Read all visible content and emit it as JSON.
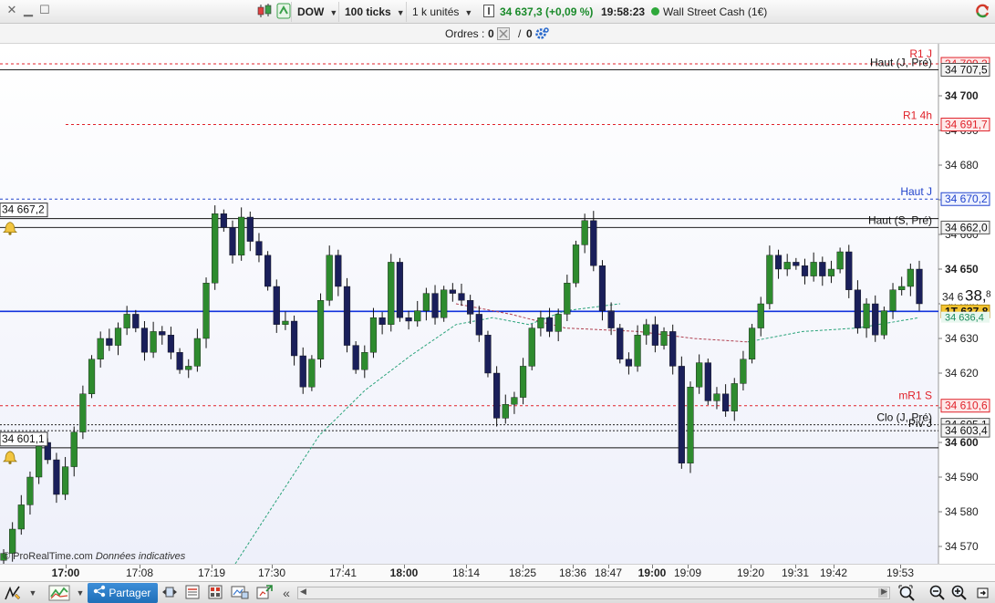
{
  "toolbar": {
    "symbol": "DOW",
    "ticks": "100 ticks",
    "units": "1 k unités",
    "price_info": "34 637,3 (+0,09 %)",
    "time": "19:58:23",
    "instrument": "Wall Street Cash (1€)"
  },
  "orders": {
    "label": "Ordres :",
    "count1": "0",
    "sep": "/",
    "count2": "0"
  },
  "watermark": "© ProRealTime.com",
  "watermark_note": "Données indicatives",
  "share_label": "Partager",
  "colors": {
    "up": "#2e8b2e",
    "down": "#1a1f5a",
    "resistance": "#e0222a",
    "support": "#222222",
    "haut_j": "#2244cc",
    "price_line": "#1133dd",
    "ma": "#2aa37a"
  },
  "chart_data": {
    "type": "candlestick",
    "ylim": [
      34565,
      34715
    ],
    "y_ticks": [
      "34 570",
      "34 580",
      "34 590",
      "34 600",
      "34 610",
      "34 620",
      "34 630",
      "34 640",
      "34 650",
      "34 660",
      "34 670",
      "34 680",
      "34 690",
      "34 700"
    ],
    "y_tick_values": [
      34570,
      34580,
      34590,
      34600,
      34610,
      34620,
      34630,
      34640,
      34650,
      34660,
      34670,
      34680,
      34690,
      34700
    ],
    "x_labels": [
      "17:00",
      "17:08",
      "17:19",
      "17:30",
      "17:41",
      "18:00",
      "18:14",
      "18:25",
      "18:36",
      "18:47",
      "19:00",
      "19:09",
      "19:20",
      "19:31",
      "19:42",
      "19:53"
    ],
    "x_bold": [
      true,
      false,
      false,
      false,
      false,
      true,
      false,
      false,
      false,
      false,
      true,
      false,
      false,
      false,
      false,
      false
    ],
    "levels": [
      {
        "name": "R1 J",
        "value": 34709.2,
        "label": "34 709,2",
        "style": "red-dash"
      },
      {
        "name": "Haut (J, Pré)",
        "value": 34707.5,
        "label": "34 707,5",
        "style": "black"
      },
      {
        "name": "R1 4h",
        "value": 34691.7,
        "label": "34 691,7",
        "style": "red-dash"
      },
      {
        "name": "Haut J",
        "value": 34670.2,
        "label": "34 670,2",
        "style": "blue-dash"
      },
      {
        "name": "Haut (S, Pré)",
        "value": 34662.0,
        "label": "34 662,0",
        "style": "black"
      },
      {
        "name": "mR1 S",
        "value": 34610.6,
        "label": "34 610,6",
        "style": "red-dash"
      },
      {
        "name": "Clo (J, Pré)",
        "value": 34605.1,
        "label": "34 605,1",
        "style": "black-dash"
      },
      {
        "name": "Piv J",
        "value": 34603.4,
        "label": "34 603,4",
        "style": "black-dash"
      }
    ],
    "alerts": [
      {
        "value": 34667.2,
        "label": "34 667,2"
      },
      {
        "value": 34601.1,
        "label": "34 601,1"
      }
    ],
    "current_price": {
      "value": 34637.8,
      "label": "1T 637,8"
    },
    "big_price_partial": "34 6",
    "big_price_main": "38,",
    "big_price_sub": "8",
    "ma_last": {
      "value": 34636.4,
      "label": "34 636,4"
    },
    "close_series": [
      34568,
      34575,
      34582,
      34590,
      34600,
      34595,
      34585,
      34593,
      34603,
      34614,
      34624,
      34630,
      34628,
      34633,
      34637,
      34633,
      34626,
      34632,
      34631,
      34626,
      34621,
      34622,
      34630,
      34646,
      34666,
      34662,
      34654,
      34665,
      34658,
      34654,
      34645,
      34634,
      34635,
      34625,
      34616,
      34624,
      34641,
      34654,
      34645,
      34628,
      34621,
      34626,
      34636,
      34634,
      34652,
      34636,
      34635,
      34638,
      34643,
      34636,
      34644,
      34643,
      34641,
      34637,
      34631,
      34620,
      34607,
      34611,
      34613,
      34622,
      34633,
      34636,
      34632,
      34637,
      34646,
      34657,
      34664,
      34651,
      34638,
      34633,
      34624,
      34622,
      34631,
      34634,
      34628,
      34632,
      34622,
      34594,
      34616,
      34623,
      34612,
      34614,
      34609,
      34617,
      34624,
      34633,
      34640,
      34654,
      34650,
      34652,
      34651,
      34648,
      34652,
      34648,
      34650,
      34655,
      34644,
      34633,
      34640,
      34631,
      34638,
      34644,
      34645,
      34650,
      34640
    ],
    "ma_series": [
      [
        258,
        34565
      ],
      [
        300,
        34582
      ],
      [
        350,
        34602
      ],
      [
        400,
        34615
      ],
      [
        450,
        34625
      ],
      [
        500,
        34634
      ],
      [
        540,
        34636
      ],
      [
        580,
        34634
      ],
      [
        620,
        34638
      ],
      [
        680,
        34640
      ]
    ],
    "ma_red_series": [
      [
        500,
        34640
      ],
      [
        560,
        34637
      ],
      [
        620,
        34633
      ],
      [
        700,
        34632
      ],
      [
        760,
        34630
      ],
      [
        820,
        34629
      ]
    ],
    "ma_green_series2": [
      [
        820,
        34629
      ],
      [
        880,
        34632
      ],
      [
        940,
        34633
      ],
      [
        1008,
        34636
      ]
    ]
  }
}
